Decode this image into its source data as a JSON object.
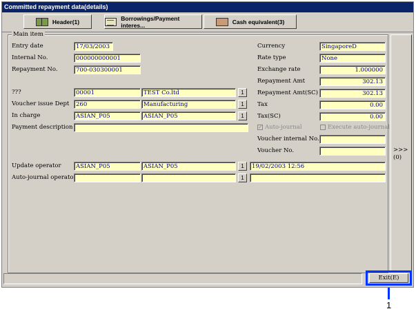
{
  "window": {
    "title": "Committed repayment data(details)"
  },
  "tabs": [
    {
      "label": "Header(1)",
      "icon": "book-icon"
    },
    {
      "label": "Borrowings/Payment interes...",
      "icon": "note-icon"
    },
    {
      "label": "Cash equivalent(3)",
      "icon": "cash-icon"
    }
  ],
  "group": {
    "title": "Main item"
  },
  "left": {
    "entry_date": {
      "label": "Entry date",
      "value": "17/03/2003"
    },
    "internal_no": {
      "label": "Internal No.",
      "value": "000000000001"
    },
    "repayment_no": {
      "label": "Repayment No.",
      "value": "700-030300001"
    },
    "unknown": {
      "label": "???",
      "code": "00001",
      "name": "TEST Co.ltd",
      "btn": "1"
    },
    "voucher_dept": {
      "label": "Voucher issue Dept",
      "code": "260",
      "name": "Manufacturing",
      "btn": "1"
    },
    "in_charge": {
      "label": "In charge",
      "code": "ASIAN_P05",
      "name": "ASIAN_P05",
      "btn": "1"
    },
    "payment_desc": {
      "label": "Payment description",
      "value": ""
    },
    "update_operator": {
      "label": "Update operator",
      "code": "ASIAN_P05",
      "name": "ASIAN_P05",
      "btn": "1",
      "datetime": "19/02/2003 12:56"
    },
    "auto_journal_operator": {
      "label": "Auto-journal operator",
      "code": "",
      "name": "",
      "btn": "1",
      "datetime": ""
    }
  },
  "right": {
    "currency": {
      "label": "Currency",
      "value": "SingaporeD"
    },
    "rate_type": {
      "label": "Rate type",
      "value": "None"
    },
    "exchange_rate": {
      "label": "Exchange rate",
      "value": "1.000000"
    },
    "repayment_amt": {
      "label": "Repayment Amt",
      "value": "302.13"
    },
    "repayment_amt_sc": {
      "label": "Repayment Amt(SC)",
      "value": "302.13"
    },
    "tax": {
      "label": "Tax",
      "value": "0.00"
    },
    "tax_sc": {
      "label": "Tax(SC)",
      "value": "0.00"
    },
    "auto_journal": {
      "label": "Auto-journal",
      "checked": true
    },
    "execute_auto_journal": {
      "label": "Execute auto-journal",
      "checked": false
    },
    "voucher_internal_no": {
      "label": "Voucher internal No.",
      "value": ""
    },
    "voucher_no": {
      "label": "Voucher No.",
      "value": ""
    }
  },
  "side_button": {
    "label": ">>>(0)"
  },
  "exit_button": {
    "label": "Exit(E)"
  },
  "callout": {
    "number": "1"
  },
  "check_mark": "✓",
  "colors": {
    "title_bg": "#0a246a",
    "field_bg": "#ffffc0",
    "value_text": "#00008b",
    "callout": "#0033ff"
  }
}
